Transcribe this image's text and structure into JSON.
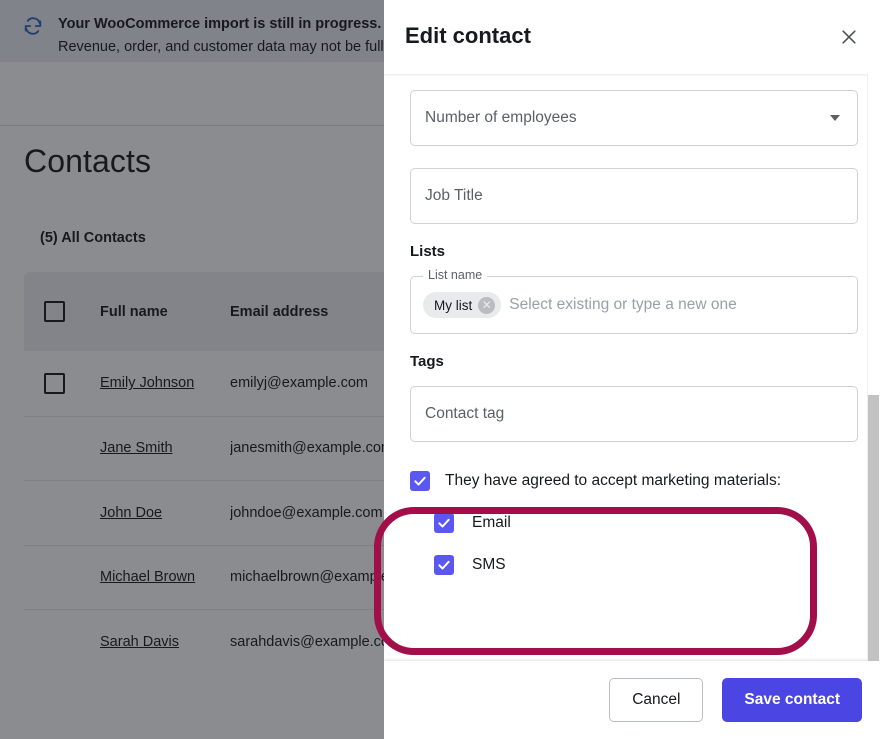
{
  "banner": {
    "icon": "sync-refresh-icon",
    "line1": "Your WooCommerce import is still in progress.",
    "line2": "Revenue, order, and customer data may not be fully"
  },
  "page": {
    "title": "Contacts",
    "filter_label": "(5) All Contacts"
  },
  "table": {
    "columns": [
      "Full name",
      "Email address"
    ],
    "rows": [
      {
        "name": "Emily Johnson",
        "email": "emilyj@example.com"
      },
      {
        "name": "Jane Smith",
        "email": "janesmith@example.com"
      },
      {
        "name": "John Doe",
        "email": "johndoe@example.com"
      },
      {
        "name": "Michael Brown",
        "email": "michaelbrown@example..."
      },
      {
        "name": "Sarah Davis",
        "email": "sarahdavis@example.com"
      }
    ]
  },
  "modal": {
    "title": "Edit contact",
    "close_icon": "close-icon",
    "fields": {
      "employees": {
        "placeholder": "Number of employees",
        "value": "",
        "icon": "chevron-down-icon"
      },
      "job_title": {
        "placeholder": "Job Title",
        "value": ""
      }
    },
    "lists": {
      "section_label": "Lists",
      "field_label": "List name",
      "chips": [
        "My list"
      ],
      "chip_remove_icon": "remove-chip-icon",
      "placeholder": "Select existing or type a new one"
    },
    "tags": {
      "section_label": "Tags",
      "placeholder": "Contact tag",
      "value": ""
    },
    "consent": {
      "main": {
        "label": "They have agreed to accept marketing materials:",
        "checked": true
      },
      "options": [
        {
          "label": "Email",
          "checked": true
        },
        {
          "label": "SMS",
          "checked": true
        }
      ]
    },
    "footer": {
      "cancel_label": "Cancel",
      "save_label": "Save contact"
    }
  },
  "colors": {
    "accent": "#4b45e4",
    "checkbox": "#5b57f2",
    "annotation": "#a10e4a",
    "banner_icon": "#2f5fc4"
  }
}
